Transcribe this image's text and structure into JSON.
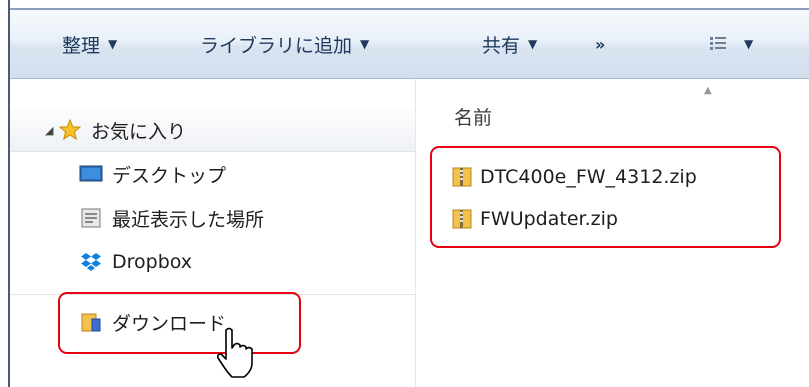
{
  "toolbar": {
    "organize_label": "整理",
    "add_to_library_label": "ライブラリに追加",
    "share_label": "共有",
    "more_label": "»",
    "dropdown_arrow": "▼"
  },
  "nav": {
    "favorites_label": "お気に入り",
    "items": [
      {
        "label": "デスクトップ",
        "icon": "desktop-icon"
      },
      {
        "label": "最近表示した場所",
        "icon": "recent-places-icon"
      },
      {
        "label": "Dropbox",
        "icon": "dropbox-icon"
      },
      {
        "label": "ダウンロード",
        "icon": "downloads-icon"
      }
    ]
  },
  "content": {
    "column_name": "名前",
    "files": [
      {
        "name": "DTC400e_FW_4312.zip",
        "icon": "zip-folder-icon"
      },
      {
        "name": "FWUpdater.zip",
        "icon": "zip-folder-icon"
      }
    ]
  },
  "colors": {
    "highlight": "#e60012",
    "toolbar_text": "#1e395b"
  }
}
